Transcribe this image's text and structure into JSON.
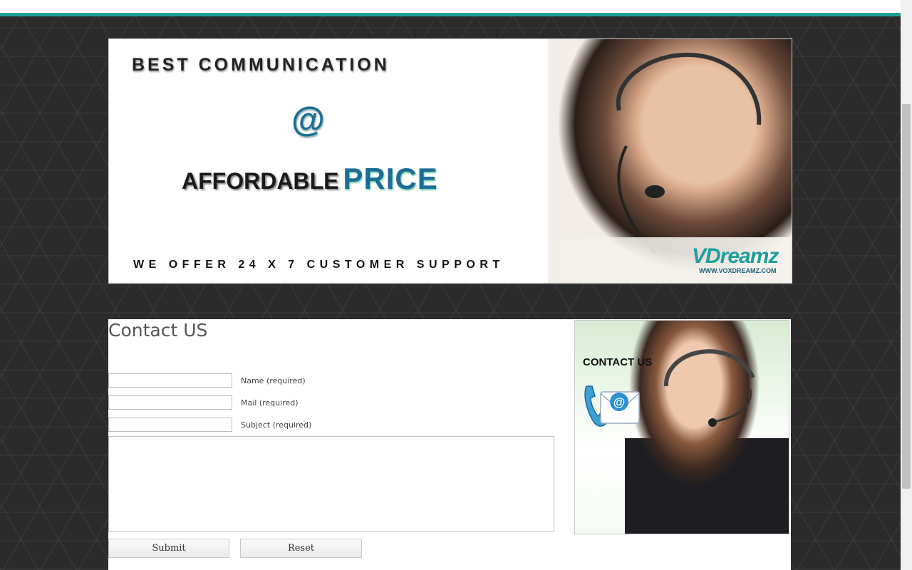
{
  "banner": {
    "headline": "BEST COMMUNICATION",
    "at_symbol": "@",
    "affordable": "AFFORDABLE",
    "price": "PRICE",
    "support": "WE OFFER 24 X 7 CUSTOMER SUPPORT",
    "logo_text": "VDreamz",
    "logo_url": "WWW.VOXDREAMZ.COM"
  },
  "page": {
    "title": "Contact US"
  },
  "form": {
    "name_label": "Name (required)",
    "mail_label": "Mail (required)",
    "subject_label": "Subject (required)",
    "name_value": "",
    "mail_value": "",
    "subject_value": "",
    "message_value": "",
    "submit_label": "Submit",
    "reset_label": "Reset"
  },
  "sidebar": {
    "heading": "CONTACT US"
  },
  "colors": {
    "accent": "#1f9e9a",
    "brand_blue": "#1c6e96"
  }
}
